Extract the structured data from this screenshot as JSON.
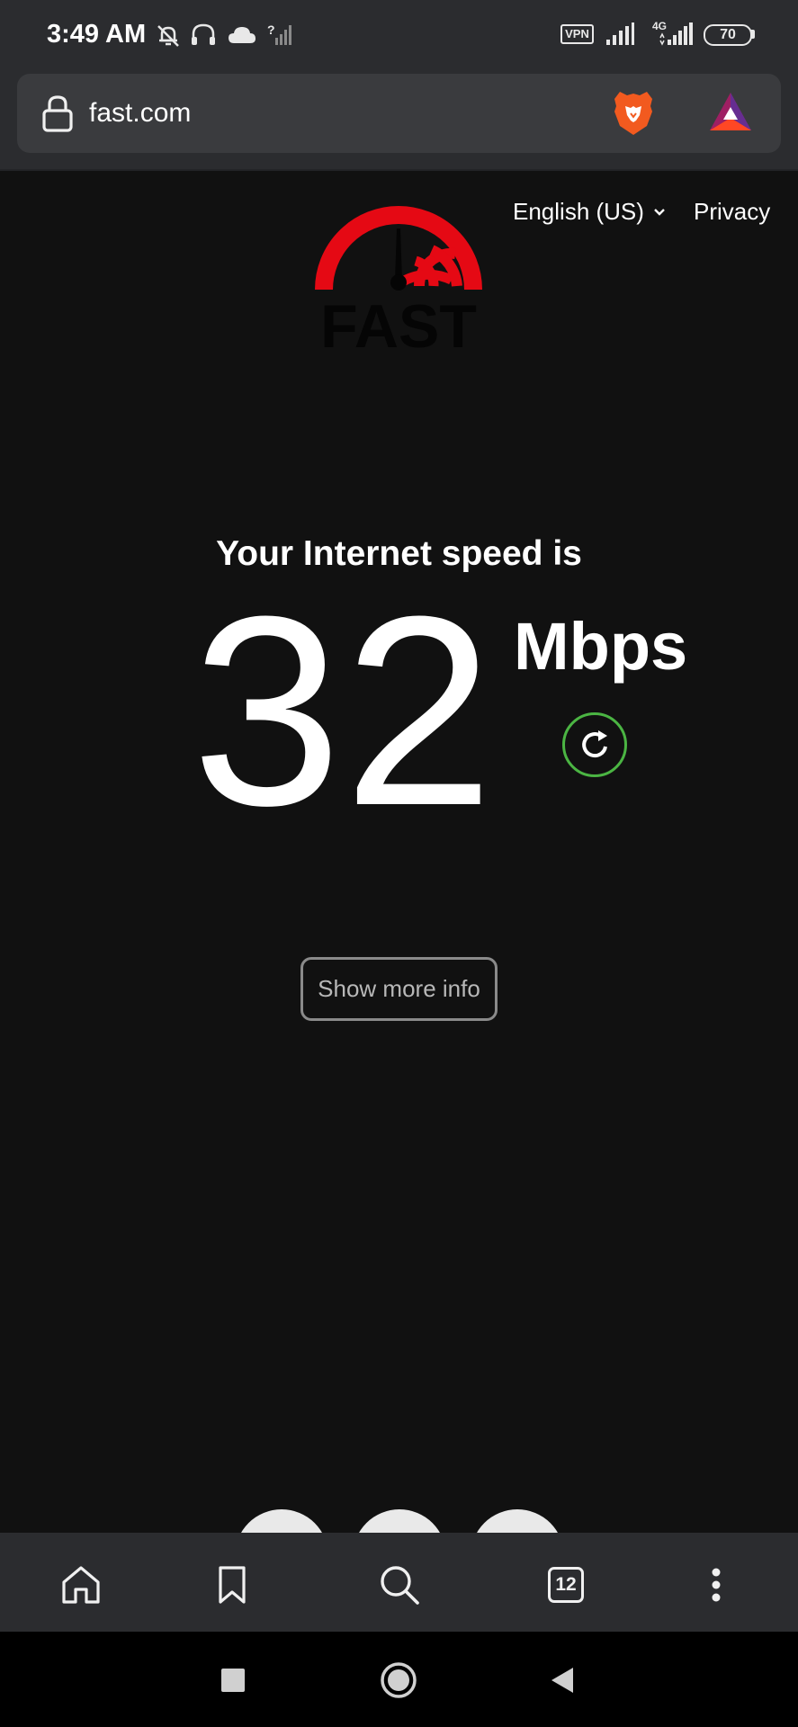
{
  "status_bar": {
    "time": "3:49 AM",
    "vpn_label": "VPN",
    "network_type": "4G",
    "battery_level": "70"
  },
  "browser": {
    "url": "fast.com",
    "tabs_count": "12"
  },
  "page": {
    "language": "English (US)",
    "privacy_label": "Privacy",
    "logo_text": "FAST",
    "speed_heading": "Your Internet speed is",
    "speed_value": "32",
    "speed_units": "Mbps",
    "more_info_label": "Show more info"
  },
  "colors": {
    "background": "#111111",
    "logo_red": "#e50914",
    "refresh_green": "#4bb543",
    "toolbar": "#2b2c2f"
  }
}
